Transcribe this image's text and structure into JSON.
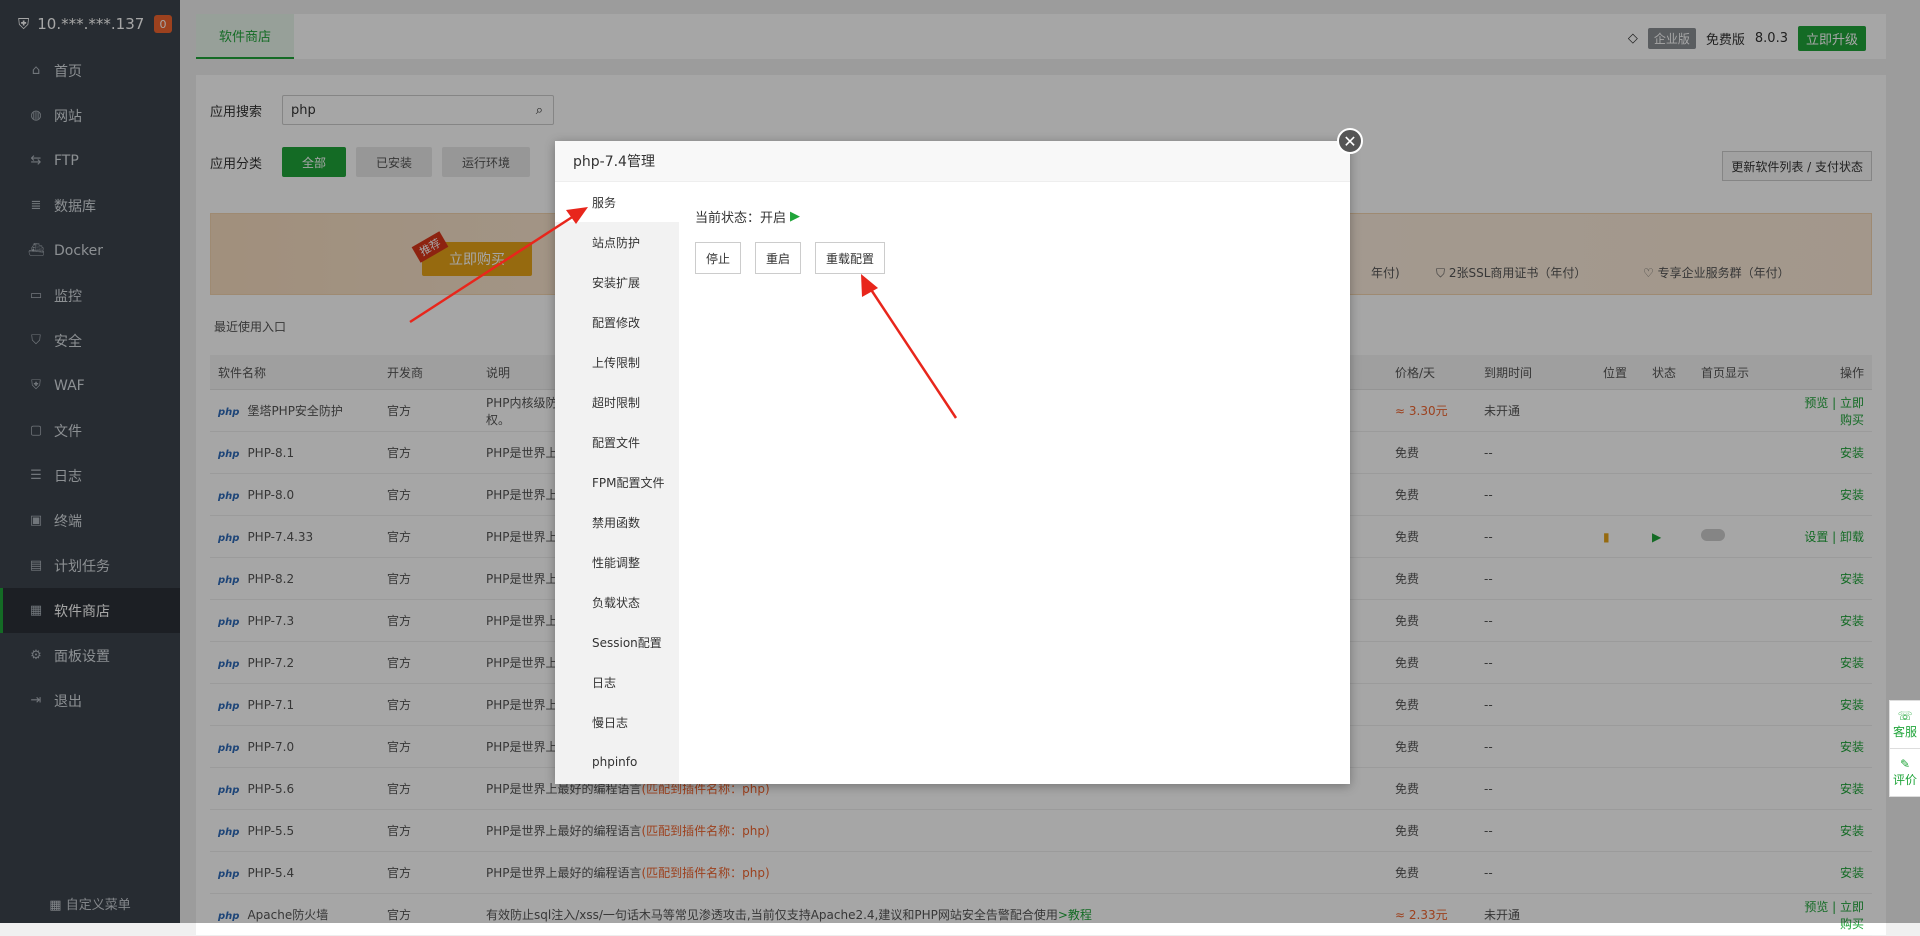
{
  "sidebar": {
    "server_ip": "10.***.***.137",
    "badge": "0",
    "items": [
      {
        "label": "首页",
        "icon": "home-icon"
      },
      {
        "label": "网站",
        "icon": "globe-icon"
      },
      {
        "label": "FTP",
        "icon": "ftp-icon"
      },
      {
        "label": "数据库",
        "icon": "database-icon"
      },
      {
        "label": "Docker",
        "icon": "docker-icon"
      },
      {
        "label": "监控",
        "icon": "monitor-icon"
      },
      {
        "label": "安全",
        "icon": "shield-icon"
      },
      {
        "label": "WAF",
        "icon": "waf-icon"
      },
      {
        "label": "文件",
        "icon": "folder-icon"
      },
      {
        "label": "日志",
        "icon": "log-icon"
      },
      {
        "label": "终端",
        "icon": "terminal-icon"
      },
      {
        "label": "计划任务",
        "icon": "calendar-icon"
      },
      {
        "label": "软件商店",
        "icon": "apps-icon"
      },
      {
        "label": "面板设置",
        "icon": "settings-icon"
      },
      {
        "label": "退出",
        "icon": "logout-icon"
      }
    ],
    "custom_menu": "自定义菜单"
  },
  "topbar": {
    "tab": "软件商店",
    "edition": "企业版",
    "free": "免费版",
    "version": "8.0.3",
    "upgrade": "立即升级"
  },
  "search": {
    "label": "应用搜索",
    "value": "php"
  },
  "category": {
    "label": "应用分类",
    "items": [
      "全部",
      "已安装",
      "运行环境"
    ]
  },
  "update_button": "更新软件列表 / 支付状态",
  "banner": {
    "tag": "推荐",
    "buy": "立即购买",
    "perks": [
      "年付)",
      "2张SSL商用证书（年付）",
      "专享企业服务群（年付）"
    ]
  },
  "recent": "最近使用入口",
  "table": {
    "headers": [
      "软件名称",
      "开发商",
      "说明",
      "价格/天",
      "到期时间",
      "位置",
      "状态",
      "首页显示",
      "操作"
    ],
    "rows": [
      {
        "name": "堡塔PHP安全防护",
        "dev": "官方",
        "desc": "PHP内核级防御",
        "desc2": "权。",
        "price": "≈ 3.30元",
        "expire": "未开通",
        "action": "预览 | 立即购买"
      },
      {
        "name": "PHP-8.1",
        "dev": "官方",
        "desc": "PHP是世界上最",
        "price": "免费",
        "expire": "--",
        "action": "安装"
      },
      {
        "name": "PHP-8.0",
        "dev": "官方",
        "desc": "PHP是世界上最",
        "price": "免费",
        "expire": "--",
        "action": "安装"
      },
      {
        "name": "PHP-7.4.33",
        "dev": "官方",
        "desc": "PHP是世界上最",
        "price": "免费",
        "expire": "--",
        "action": "设置 | 卸载"
      },
      {
        "name": "PHP-8.2",
        "dev": "官方",
        "desc": "PHP是世界上最",
        "price": "免费",
        "expire": "--",
        "action": "安装"
      },
      {
        "name": "PHP-7.3",
        "dev": "官方",
        "desc": "PHP是世界上最",
        "price": "免费",
        "expire": "--",
        "action": "安装"
      },
      {
        "name": "PHP-7.2",
        "dev": "官方",
        "desc": "PHP是世界上最",
        "price": "免费",
        "expire": "--",
        "action": "安装"
      },
      {
        "name": "PHP-7.1",
        "dev": "官方",
        "desc": "PHP是世界上最",
        "price": "免费",
        "expire": "--",
        "action": "安装"
      },
      {
        "name": "PHP-7.0",
        "dev": "官方",
        "desc": "PHP是世界上最",
        "price": "免费",
        "expire": "--",
        "action": "安装"
      },
      {
        "name": "PHP-5.6",
        "dev": "官方",
        "desc": "PHP是世界上最好的编程语言",
        "desc_note": "(匹配到插件名称：php)",
        "price": "免费",
        "expire": "--",
        "action": "安装"
      },
      {
        "name": "PHP-5.5",
        "dev": "官方",
        "desc": "PHP是世界上最好的编程语言",
        "desc_note": "(匹配到插件名称：php)",
        "price": "免费",
        "expire": "--",
        "action": "安装"
      },
      {
        "name": "PHP-5.4",
        "dev": "官方",
        "desc": "PHP是世界上最好的编程语言",
        "desc_note": "(匹配到插件名称：php)",
        "price": "免费",
        "expire": "--",
        "action": "安装"
      },
      {
        "name": "Apache防火墙",
        "dev": "官方",
        "desc": "有效防止sql注入/xss/一句话木马等常见渗透攻击,当前仅支持Apache2.4,建议和PHP网站安全告警配合使用",
        "desc_link": ">教程",
        "price": "≈ 2.33元",
        "expire": "未开通",
        "action": "预览 | 立即购买"
      }
    ]
  },
  "modal": {
    "title": "php-7.4管理",
    "menu": [
      "服务",
      "站点防护",
      "安装扩展",
      "配置修改",
      "上传限制",
      "超时限制",
      "配置文件",
      "FPM配置文件",
      "禁用函数",
      "性能调整",
      "负载状态",
      "Session配置",
      "日志",
      "慢日志",
      "phpinfo"
    ],
    "status_label": "当前状态：",
    "status_value": "开启",
    "buttons": [
      "停止",
      "重启",
      "重载配置"
    ]
  },
  "floatbar": {
    "service": "客服",
    "rate": "评价"
  }
}
